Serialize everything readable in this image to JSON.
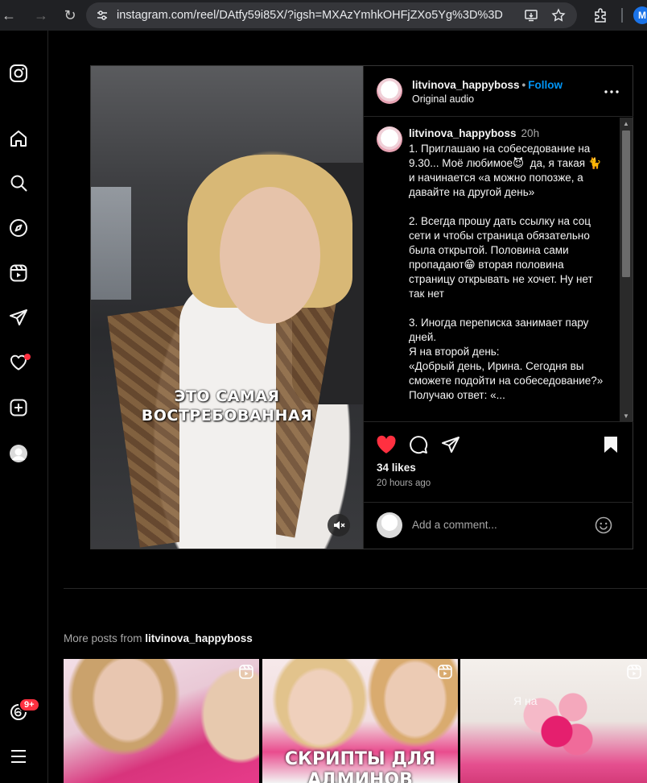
{
  "browser": {
    "url": "instagram.com/reel/DAtfy59i85X/?igsh=MXAzYmhkOHFjZXo5Yg%3D%3D",
    "profile_initial": "M"
  },
  "sidenav": {
    "threads_badge": "9+"
  },
  "post": {
    "username": "litvinova_happyboss",
    "follow_label": "Follow",
    "separator": "•",
    "audio": "Original audio",
    "video_overlay_line1": "ЭТО САМАЯ",
    "video_overlay_line2": "ВОСТРЕБОВАННАЯ",
    "caption": {
      "username": "litvinova_happyboss",
      "time": "20h",
      "text": "1. Приглашаю на собеседование на 9.30... Моё любимое😈  да, я такая 🐈\nи начинается «а можно попозже, а давайте на другой день»\n\n2. Всегда прошу дать ссылку на соц сети и чтобы страница обязательно была открытой. Половина сами пропадают😁 вторая половина страницу открывать не хочет. Ну нет так нет\n\n3. Иногда переписка занимает пару дней.\nЯ на второй день:\n«Добрый день, Ирина. Сегодня вы сможете подойти на собеседование?»\nПолучаю ответ: «..."
    },
    "likes": "34 likes",
    "posted_ago": "20 hours ago",
    "comment_placeholder": "Add a comment..."
  },
  "more_posts": {
    "prefix": "More posts from ",
    "username": "litvinova_happyboss",
    "tiles": [
      {
        "overlay": ""
      },
      {
        "overlay_line1": "СКРИПТЫ ДЛЯ",
        "overlay_line2": "АДМИНОВ"
      },
      {
        "overlay": "",
        "neon": "Я на"
      }
    ]
  },
  "colors": {
    "accent_blue": "#0095f6",
    "like_red": "#ff3040",
    "background": "#000000"
  }
}
